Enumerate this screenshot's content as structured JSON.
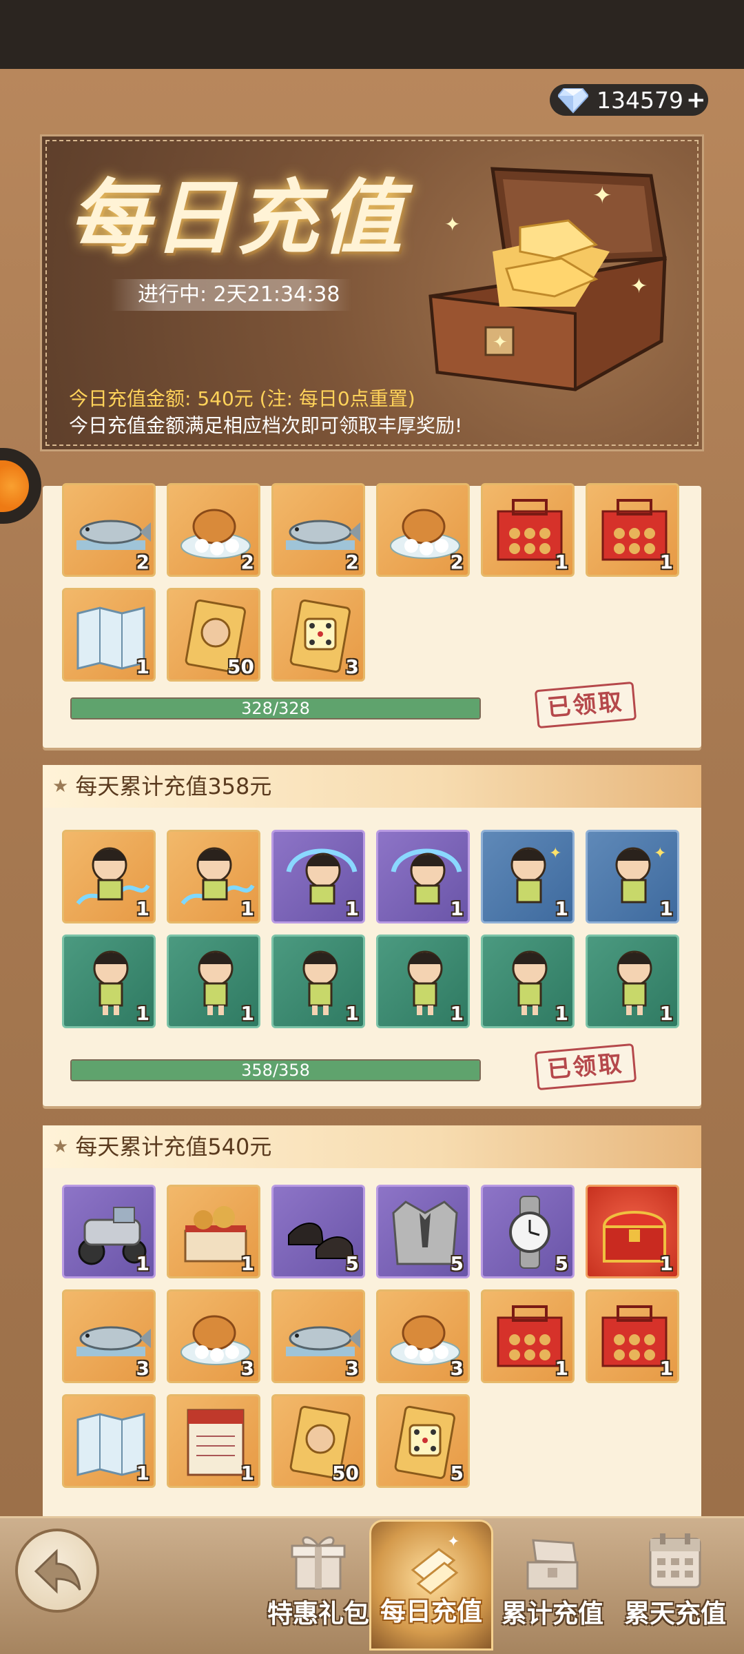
{
  "currency": {
    "gems": "134579",
    "plus": "+"
  },
  "banner": {
    "title": "每日充值",
    "timer": "进行中: 2天21:34:38",
    "today_amount": "今日充值金额: 540元 (注: 每日0点重置)",
    "hint": "今日充值金额满足相应档次即可领取丰厚奖励!"
  },
  "tier_partial": {
    "row1": [
      {
        "icon": "fish-icon",
        "qty": "2",
        "bg": "orange"
      },
      {
        "icon": "roast-chicken-icon",
        "qty": "2",
        "bg": "orange"
      },
      {
        "icon": "fish-icon",
        "qty": "2",
        "bg": "orange"
      },
      {
        "icon": "roast-chicken-icon",
        "qty": "2",
        "bg": "orange"
      },
      {
        "icon": "mooncake-box-icon",
        "qty": "1",
        "bg": "orange"
      },
      {
        "icon": "mooncake-box-icon",
        "qty": "1",
        "bg": "orange"
      }
    ],
    "row2": [
      {
        "icon": "map-icon",
        "qty": "1",
        "bg": "orange"
      },
      {
        "icon": "fist-card-icon",
        "qty": "50",
        "bg": "orange"
      },
      {
        "icon": "dice-card-icon",
        "qty": "3",
        "bg": "orange"
      }
    ],
    "progress_text": "328/328",
    "progress": 1.0,
    "status": "已领取"
  },
  "tier_358": {
    "title": "每天累计充值358元",
    "row1": [
      {
        "icon": "character-water-icon",
        "qty": "1",
        "bg": "orange"
      },
      {
        "icon": "character-water-icon",
        "qty": "1",
        "bg": "orange"
      },
      {
        "icon": "character-spin-icon",
        "qty": "1",
        "bg": "purple"
      },
      {
        "icon": "character-spin-icon",
        "qty": "1",
        "bg": "purple"
      },
      {
        "icon": "character-sparkle-icon",
        "qty": "1",
        "bg": "blue"
      },
      {
        "icon": "character-sparkle-icon",
        "qty": "1",
        "bg": "blue"
      }
    ],
    "row2": [
      {
        "icon": "character-idle-icon",
        "qty": "1",
        "bg": "green"
      },
      {
        "icon": "character-idle-icon",
        "qty": "1",
        "bg": "green"
      },
      {
        "icon": "character-idle-icon",
        "qty": "1",
        "bg": "green"
      },
      {
        "icon": "character-idle-icon",
        "qty": "1",
        "bg": "green"
      },
      {
        "icon": "character-idle-icon",
        "qty": "1",
        "bg": "green"
      },
      {
        "icon": "character-idle-icon",
        "qty": "1",
        "bg": "green"
      }
    ],
    "progress_text": "358/358",
    "progress": 1.0,
    "status": "已领取"
  },
  "tier_540": {
    "title": "每天累计充值540元",
    "row1": [
      {
        "icon": "motorcycle-icon",
        "qty": "1",
        "bg": "purple"
      },
      {
        "icon": "gift-basket-icon",
        "qty": "1",
        "bg": "orange"
      },
      {
        "icon": "leather-shoes-icon",
        "qty": "5",
        "bg": "purple"
      },
      {
        "icon": "suit-jacket-icon",
        "qty": "5",
        "bg": "purple"
      },
      {
        "icon": "wristwatch-icon",
        "qty": "5",
        "bg": "purple"
      },
      {
        "icon": "treasure-chest-icon",
        "qty": "1",
        "bg": "red"
      }
    ],
    "row2": [
      {
        "icon": "fish-icon",
        "qty": "3",
        "bg": "orange"
      },
      {
        "icon": "roast-chicken-icon",
        "qty": "3",
        "bg": "orange"
      },
      {
        "icon": "fish-icon",
        "qty": "3",
        "bg": "orange"
      },
      {
        "icon": "roast-chicken-icon",
        "qty": "3",
        "bg": "orange"
      },
      {
        "icon": "mooncake-box-icon",
        "qty": "1",
        "bg": "orange"
      },
      {
        "icon": "mooncake-box-icon",
        "qty": "1",
        "bg": "orange"
      }
    ],
    "row3": [
      {
        "icon": "map-icon",
        "qty": "1",
        "bg": "orange"
      },
      {
        "icon": "invitation-book-icon",
        "qty": "1",
        "bg": "orange"
      },
      {
        "icon": "fist-card-icon",
        "qty": "50",
        "bg": "orange"
      },
      {
        "icon": "dice-card-icon",
        "qty": "5",
        "bg": "orange"
      }
    ]
  },
  "nav": {
    "items": [
      {
        "label": "特惠礼包",
        "icon": "gift-icon",
        "active": false
      },
      {
        "label": "每日充值",
        "icon": "gold-bars-icon",
        "active": true
      },
      {
        "label": "累计充值",
        "icon": "open-chest-icon",
        "active": false
      },
      {
        "label": "累天充值",
        "icon": "calendar-icon",
        "active": false
      }
    ]
  },
  "colors": {
    "accent_gold": "#ffd35a",
    "claimed_red": "#b5484b",
    "progress_green": "#5fa36d"
  }
}
